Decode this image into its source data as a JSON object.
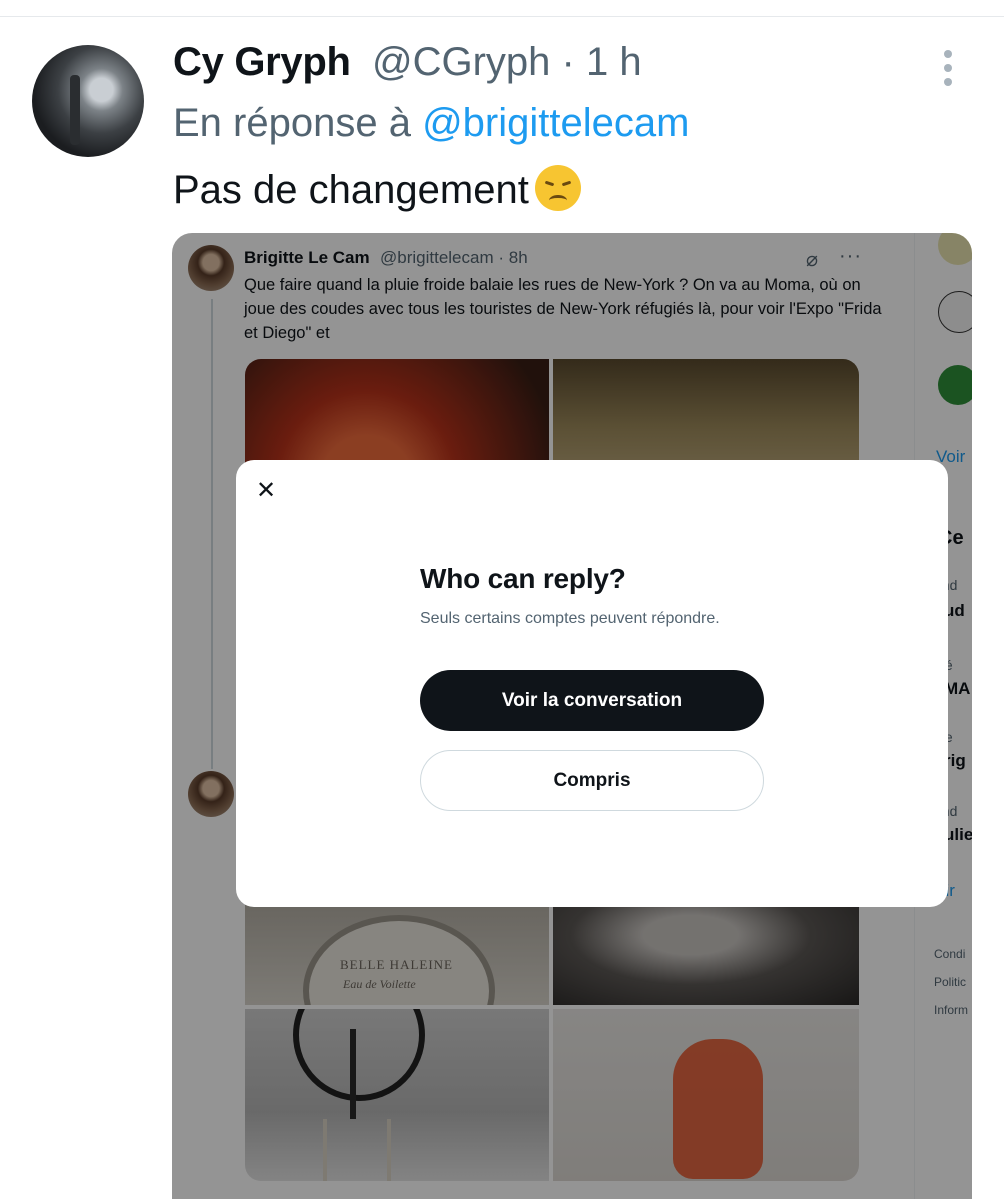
{
  "tweet": {
    "author_name": "Cy Gryph",
    "author_handle": "@CGryph",
    "separator": "·",
    "time": "1 h",
    "reply_prefix": "En réponse à",
    "reply_mention": "@brigittelecam",
    "text": "Pas de changement",
    "emoji_icon": "disappointed-face-emoji",
    "more_icon": "vertical-ellipsis-icon"
  },
  "embedded": {
    "author_name": "Brigitte Le Cam",
    "author_handle": "@brigittelecam · 8h",
    "grok_icon": "grok-icon",
    "more_label": "···",
    "text": "Que faire quand la pluie froide balaie les rues de New-York ? On va au Moma, où on joue des coudes avec  tous les touristes de New-York réfugiés là, pour voir l'Expo \"Frida et Diego\" et",
    "photo_label_1": "BELLE HALEINE",
    "photo_label_2": "Eau de Voilette",
    "right_column": {
      "link_1": "Voir",
      "heading": "Ce",
      "item_1_small": "end",
      "item_1_bold": "ud",
      "item_2_small": "élé",
      "item_2_bold": "MA",
      "item_3_small": "cte",
      "item_3_bold": "rig",
      "item_4_small": "end",
      "item_4_bold": "ulie",
      "link_2": "oir",
      "footer_1": "Condi",
      "footer_2": "Politic",
      "footer_3": "Inform"
    }
  },
  "modal": {
    "close_icon": "close-icon",
    "close_glyph": "✕",
    "title": "Who can reply?",
    "subtitle": "Seuls certains comptes peuvent répondre.",
    "primary_button": "Voir la conversation",
    "secondary_button": "Compris"
  },
  "colors": {
    "link": "#1d9bf0",
    "text": "#0f1419",
    "muted": "#536471",
    "primary_button_bg": "#0f1419",
    "overlay": "rgba(0,0,0,0.42)"
  }
}
